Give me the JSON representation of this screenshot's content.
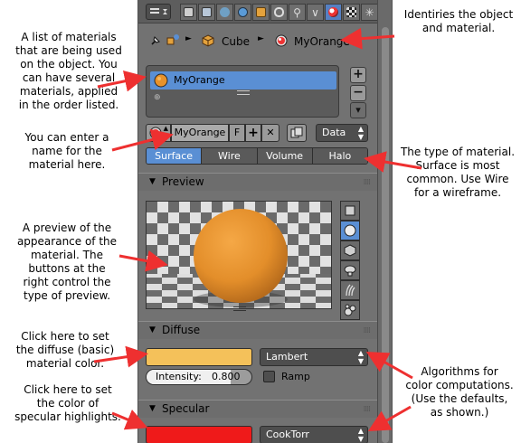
{
  "annotations": {
    "materials_list": "A list of materials\nthat are being used\non the object.  You\ncan have several\nmaterials, applied\nin the order listed.",
    "identify": "Identiries the object\nand material.",
    "name_field": "You can enter a\nname for the\nmaterial here.",
    "material_type": "The type of material.\nSurface is most\ncommon.  Use Wire\nfor a wireframe.",
    "preview": "A preview of the\nappearance of the\nmaterial.  The\nbuttons at the\nright control the\ntype of preview.",
    "diffuse": "Click here to set\nthe diffuse (basic)\nmaterial color.",
    "specular": "Click here to set\nthe color of\nspecular highlights.",
    "algorithms": "Algorithms for\ncolor computations.\n(Use the defaults,\nas shown.)"
  },
  "breadcrumb": {
    "object": "Cube",
    "material": "MyOrange",
    "icons": [
      "pin-icon",
      "object-icon",
      "cube-icon",
      "material-icon"
    ]
  },
  "materials_list": {
    "items": [
      "MyOrange"
    ],
    "buttons": [
      "+",
      "−",
      "▾"
    ]
  },
  "id_row": {
    "material_name": "MyOrange",
    "fake_user": "F",
    "add": "+",
    "remove": "✕",
    "link": "Data"
  },
  "type_tabs": [
    "Surface",
    "Wire",
    "Volume",
    "Halo"
  ],
  "type_tabs_active": 0,
  "preview": {
    "title": "Preview",
    "types": [
      "plane-icon",
      "sphere-icon",
      "cube-icon",
      "monkey-icon",
      "hair-icon",
      "sphere-monster-icon"
    ],
    "active_type": 1
  },
  "diffuse": {
    "title": "Diffuse",
    "color": "#f4c15a",
    "shader": "Lambert",
    "intensity_label": "Intensity:",
    "intensity_value": "0.800",
    "intensity": 0.8,
    "ramp_label": "Ramp"
  },
  "specular": {
    "title": "Specular",
    "color": "#ef1a1a",
    "shader": "CookTorr"
  },
  "colors": {
    "panel": "#727272",
    "accent_blue": "#5a8fd4",
    "arrow_red": "#ee3030",
    "sphere_orange": "#e8922a"
  }
}
